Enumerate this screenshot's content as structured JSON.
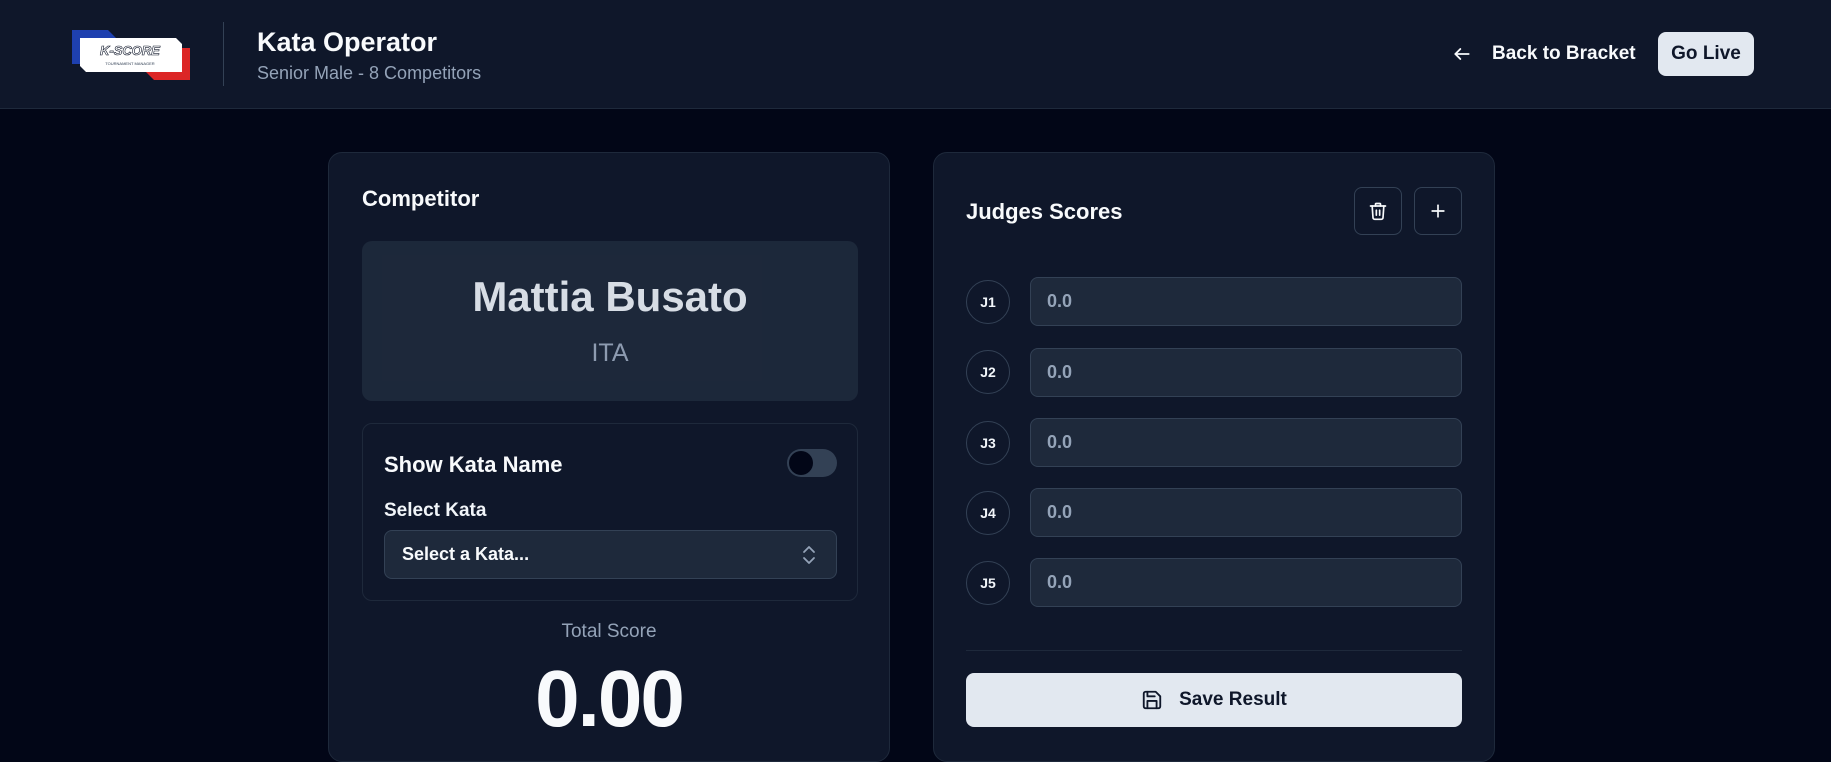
{
  "header": {
    "logo_text": "K-SCORE",
    "logo_subtext": "TOURNAMENT MANAGER",
    "title": "Kata Operator",
    "subtitle": "Senior Male - 8 Competitors",
    "back_label": "Back to Bracket",
    "go_live_label": "Go Live"
  },
  "competitor_card": {
    "heading": "Competitor",
    "name": "Mattia Busato",
    "country": "ITA",
    "show_kata_label": "Show Kata Name",
    "show_kata_enabled": false,
    "select_label": "Select Kata",
    "select_value": "Select a Kata...",
    "total_label": "Total Score",
    "total_value": "0.00"
  },
  "judges_card": {
    "heading": "Judges Scores",
    "judges": [
      {
        "label": "J1",
        "placeholder": "0.0"
      },
      {
        "label": "J2",
        "placeholder": "0.0"
      },
      {
        "label": "J3",
        "placeholder": "0.0"
      },
      {
        "label": "J4",
        "placeholder": "0.0"
      },
      {
        "label": "J5",
        "placeholder": "0.0"
      }
    ],
    "save_label": "Save Result"
  },
  "colors": {
    "background": "#020617",
    "card": "#0f172a",
    "input": "#1e293b",
    "button_light": "#e2e8f0",
    "logo_blue": "#1e40af",
    "logo_red": "#dc2626"
  }
}
